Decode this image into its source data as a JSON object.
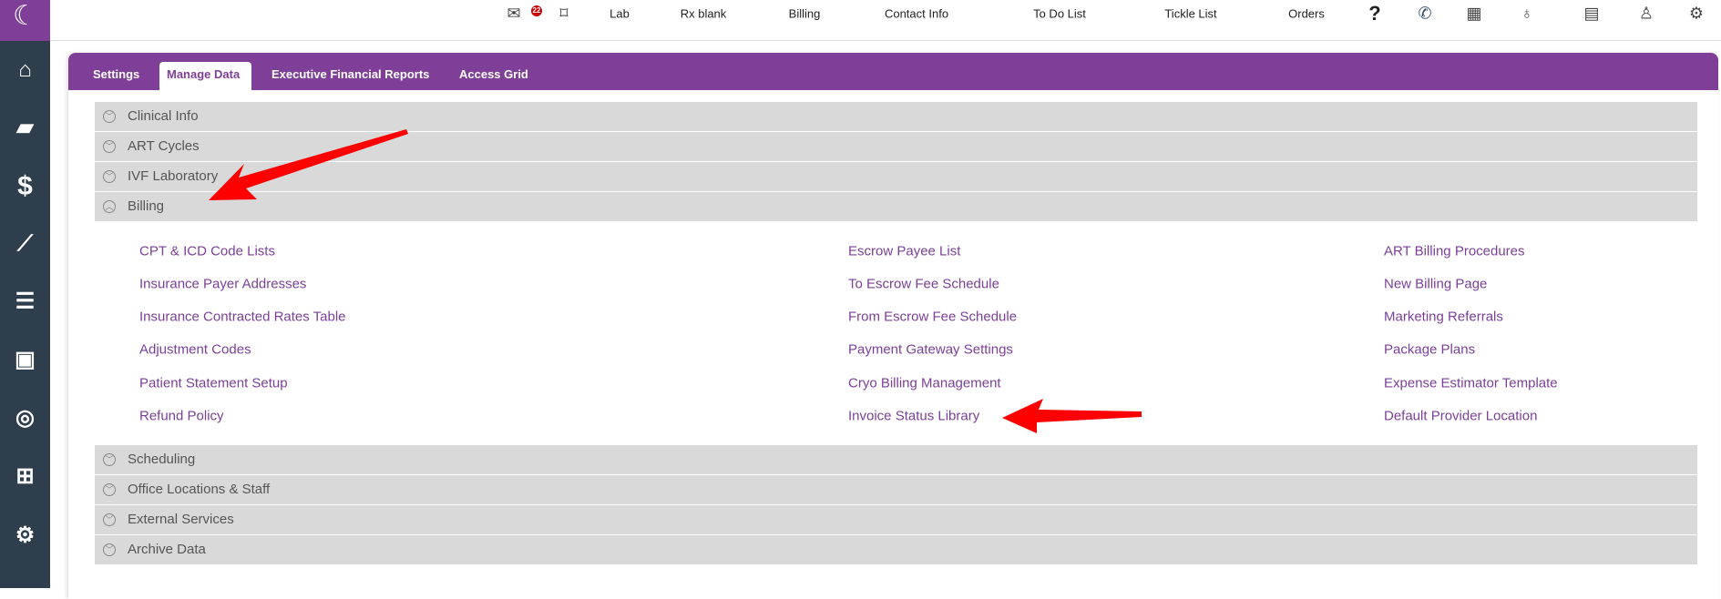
{
  "topnav": {
    "items": [
      "Lab",
      "Rx blank",
      "Billing",
      "Contact Info",
      "To Do List",
      "Tickle List",
      "Orders"
    ],
    "mail_badge": "22",
    "help": "?"
  },
  "tabs": [
    "Settings",
    "Manage Data",
    "Executive Financial Reports",
    "Access Grid"
  ],
  "active_tab": "Manage Data",
  "sections_before": [
    "Clinical Info",
    "ART Cycles",
    "IVF Laboratory",
    "Billing"
  ],
  "sections_after": [
    "Scheduling",
    "Office Locations & Staff",
    "External Services",
    "Archive Data"
  ],
  "billing_links": {
    "col1": [
      "CPT & ICD Code Lists",
      "Insurance Payer Addresses",
      "Insurance Contracted Rates Table",
      "Adjustment Codes",
      "Patient Statement Setup",
      "Refund Policy"
    ],
    "col2": [
      "Escrow Payee List",
      "To Escrow Fee Schedule",
      "From Escrow Fee Schedule",
      "Payment Gateway Settings",
      "Cryo Billing Management",
      "Invoice Status Library"
    ],
    "col3": [
      "ART Billing Procedures",
      "New Billing Page",
      "Marketing Referrals",
      "Package Plans",
      "Expense Estimator Template",
      "Default Provider Location"
    ]
  },
  "colors": {
    "brand": "#7f3f98",
    "sidebar": "#2f3e4c",
    "link": "#7b3f9a",
    "annotation_arrow": "#ff0000"
  }
}
